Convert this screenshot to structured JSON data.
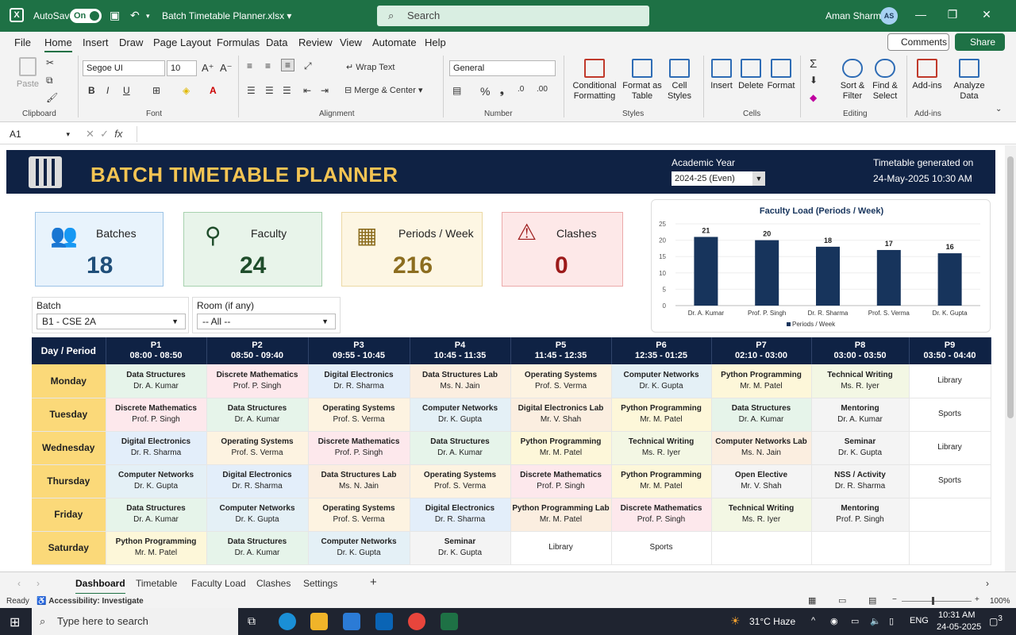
{
  "titlebar": {
    "autosave_label": "AutoSave",
    "autosave_state": "On",
    "doc_name": "Batch Timetable Planner.xlsx",
    "search_placeholder": "Search",
    "user_name": "Aman Sharma",
    "user_initials": "AS"
  },
  "menu": [
    "File",
    "Home",
    "Insert",
    "Draw",
    "Page Layout",
    "Formulas",
    "Data",
    "Review",
    "View",
    "Automate",
    "Help"
  ],
  "menu_active": "Home",
  "actions": {
    "comments": "Comments",
    "share": "Share"
  },
  "ribbon": {
    "paste": "Paste",
    "font_name": "Segoe UI",
    "font_size": "10",
    "wrap_text": "Wrap Text",
    "merge_center": "Merge & Center",
    "number_format": "General",
    "conditional_formatting": "Conditional Formatting",
    "format_as_table": "Format as Table",
    "cell_styles": "Cell Styles",
    "insert": "Insert",
    "delete": "Delete",
    "format": "Format",
    "sort_filter": "Sort & Filter",
    "find_select": "Find & Select",
    "add_ins": "Add-ins",
    "analyze_data": "Analyze Data",
    "groups": {
      "clipboard": "Clipboard",
      "font": "Font",
      "alignment": "Alignment",
      "number": "Number",
      "styles": "Styles",
      "cells": "Cells",
      "editing": "Editing",
      "addins": "Add-ins"
    }
  },
  "formula_bar": {
    "name_box": "A1",
    "fx": "fx",
    "value": ""
  },
  "dashboard": {
    "title": "BATCH TIMETABLE PLANNER",
    "academic_year_label": "Academic Year",
    "academic_year": "2024-25 (Even)",
    "generated_label": "Timetable generated on",
    "generated_time": "24-May-2025 10:30 AM",
    "kpis": [
      {
        "label": "Batches",
        "value": "18",
        "color": "#1f4e79",
        "bg": "#e8f3fc",
        "border": "#9cc3e6"
      },
      {
        "label": "Faculty",
        "value": "24",
        "color": "#1f4d2b",
        "bg": "#e8f4ea",
        "border": "#a7d1ae"
      },
      {
        "label": "Periods / Week",
        "value": "216",
        "color": "#8c6d1f",
        "bg": "#fdf6e3",
        "border": "#ecd9a4"
      },
      {
        "label": "Clashes",
        "value": "0",
        "color": "#9c1a1a",
        "bg": "#fde8e8",
        "border": "#ecaaaa"
      }
    ],
    "batch_label": "Batch",
    "batch_value": "B1 - CSE 2A",
    "room_label": "Room (if any)",
    "room_value": "-- All --"
  },
  "chart_data": {
    "type": "bar",
    "title": "Faculty Load (Periods / Week)",
    "categories": [
      "Dr. A. Kumar",
      "Prof. P. Singh",
      "Dr. R. Sharma",
      "Prof. S. Verma",
      "Dr. K. Gupta"
    ],
    "series": [
      {
        "name": "Periods / Week",
        "values": [
          21,
          20,
          18,
          17,
          16
        ]
      }
    ],
    "ylim": [
      0,
      25
    ],
    "yticks": [
      0,
      5,
      10,
      15,
      20,
      25
    ],
    "legend": "bottom",
    "bar_color": "#17345c"
  },
  "timetable": {
    "corner": "Day / Period",
    "periods": [
      {
        "name": "P1",
        "time": "08:00 - 08:50"
      },
      {
        "name": "P2",
        "time": "08:50 - 09:40"
      },
      {
        "name": "P3",
        "time": "09:55 - 10:45"
      },
      {
        "name": "P4",
        "time": "10:45 - 11:35"
      },
      {
        "name": "P5",
        "time": "11:45 - 12:35"
      },
      {
        "name": "P6",
        "time": "12:35 - 01:25"
      },
      {
        "name": "P7",
        "time": "02:10 - 03:00"
      },
      {
        "name": "P8",
        "time": "03:00 - 03:50"
      },
      {
        "name": "P9",
        "time": "03:50 - 04:40"
      }
    ],
    "days": [
      {
        "day": "Monday",
        "cells": [
          {
            "s": "Data Structures",
            "f": "Dr. A. Kumar"
          },
          {
            "s": "Discrete Mathematics",
            "f": "Prof. P. Singh"
          },
          {
            "s": "Digital Electronics",
            "f": "Dr. R. Sharma"
          },
          {
            "s": "Data Structures Lab",
            "f": "Ms. N. Jain"
          },
          {
            "s": "Operating Systems",
            "f": "Prof. S. Verma"
          },
          {
            "s": "Computer Networks",
            "f": "Dr. K. Gupta"
          },
          {
            "s": "Python Programming",
            "f": "Mr. M. Patel"
          },
          {
            "s": "Technical Writing",
            "f": "Ms. R. Iyer"
          },
          {
            "s": "",
            "f": "",
            "plain": "Library"
          }
        ]
      },
      {
        "day": "Tuesday",
        "cells": [
          {
            "s": "Discrete Mathematics",
            "f": "Prof. P. Singh"
          },
          {
            "s": "Data Structures",
            "f": "Dr. A. Kumar"
          },
          {
            "s": "Operating Systems",
            "f": "Prof. S. Verma"
          },
          {
            "s": "Computer Networks",
            "f": "Dr. K. Gupta"
          },
          {
            "s": "Digital Electronics Lab",
            "f": "Mr. V. Shah"
          },
          {
            "s": "Python Programming",
            "f": "Mr. M. Patel"
          },
          {
            "s": "Data Structures",
            "f": "Dr. A. Kumar"
          },
          {
            "s": "Mentoring",
            "f": "Dr. A. Kumar"
          },
          {
            "s": "",
            "f": "",
            "plain": "Sports"
          }
        ]
      },
      {
        "day": "Wednesday",
        "cells": [
          {
            "s": "Digital Electronics",
            "f": "Dr. R. Sharma"
          },
          {
            "s": "Operating Systems",
            "f": "Prof. S. Verma"
          },
          {
            "s": "Discrete Mathematics",
            "f": "Prof. P. Singh"
          },
          {
            "s": "Data Structures",
            "f": "Dr. A. Kumar"
          },
          {
            "s": "Python Programming",
            "f": "Mr. M. Patel"
          },
          {
            "s": "Technical Writing",
            "f": "Ms. R. Iyer"
          },
          {
            "s": "Computer Networks Lab",
            "f": "Ms. N. Jain"
          },
          {
            "s": "Seminar",
            "f": "Dr. K. Gupta"
          },
          {
            "s": "",
            "f": "",
            "plain": "Library"
          }
        ]
      },
      {
        "day": "Thursday",
        "cells": [
          {
            "s": "Computer Networks",
            "f": "Dr. K. Gupta"
          },
          {
            "s": "Digital Electronics",
            "f": "Dr. R. Sharma"
          },
          {
            "s": "Data Structures Lab",
            "f": "Ms. N. Jain"
          },
          {
            "s": "Operating Systems",
            "f": "Prof. S. Verma"
          },
          {
            "s": "Discrete Mathematics",
            "f": "Prof. P. Singh"
          },
          {
            "s": "Python Programming",
            "f": "Mr. M. Patel"
          },
          {
            "s": "Open Elective",
            "f": "Mr. V. Shah"
          },
          {
            "s": "NSS / Activity",
            "f": "Dr. R. Sharma"
          },
          {
            "s": "",
            "f": "",
            "plain": "Sports"
          }
        ]
      },
      {
        "day": "Friday",
        "cells": [
          {
            "s": "Data Structures",
            "f": "Dr. A. Kumar"
          },
          {
            "s": "Computer Networks",
            "f": "Dr. K. Gupta"
          },
          {
            "s": "Operating Systems",
            "f": "Prof. S. Verma"
          },
          {
            "s": "Digital Electronics",
            "f": "Dr. R. Sharma"
          },
          {
            "s": "Python Programming Lab",
            "f": "Mr. M. Patel"
          },
          {
            "s": "Discrete Mathematics",
            "f": "Prof. P. Singh"
          },
          {
            "s": "Technical Writing",
            "f": "Ms. R. Iyer"
          },
          {
            "s": "Mentoring",
            "f": "Prof. P. Singh"
          },
          {
            "s": "",
            "f": "",
            "plain": ""
          }
        ]
      },
      {
        "day": "Saturday",
        "cells": [
          {
            "s": "Python Programming",
            "f": "Mr. M. Patel"
          },
          {
            "s": "Data Structures",
            "f": "Dr. A. Kumar"
          },
          {
            "s": "Computer Networks",
            "f": "Dr. K. Gupta"
          },
          {
            "s": "Seminar",
            "f": "Dr. K. Gupta"
          },
          {
            "s": "",
            "f": "",
            "plain": "Library"
          },
          {
            "s": "",
            "f": "",
            "plain": "Sports"
          },
          {
            "s": "",
            "f": "",
            "plain": ""
          },
          {
            "s": "",
            "f": "",
            "plain": ""
          },
          {
            "s": "",
            "f": "",
            "plain": ""
          }
        ]
      }
    ],
    "subject_colors": {
      "Data Structures": "#e6f4ea",
      "Discrete Mathematics": "#fde8ec",
      "Digital Electronics": "#e3eefa",
      "Operating Systems": "#fdf3e1",
      "Computer Networks": "#e4f0f6",
      "Python Programming": "#fdf7d9",
      "Technical Writing": "#f3f7e4",
      "Lab": "#fbeee0",
      "Other": "#f4f4f4"
    }
  },
  "sheet_tabs": [
    "Dashboard",
    "Timetable",
    "Faculty Load",
    "Clashes",
    "Settings"
  ],
  "sheet_active": "Dashboard",
  "statusbar": {
    "ready": "Ready",
    "accessibility": "Accessibility: Investigate",
    "zoom": "100%"
  },
  "taskbar": {
    "search_placeholder": "Type here to search",
    "weather": "31°C  Haze",
    "lang": "ENG",
    "time": "10:31 AM",
    "date": "24-05-2025",
    "notif": "3"
  }
}
